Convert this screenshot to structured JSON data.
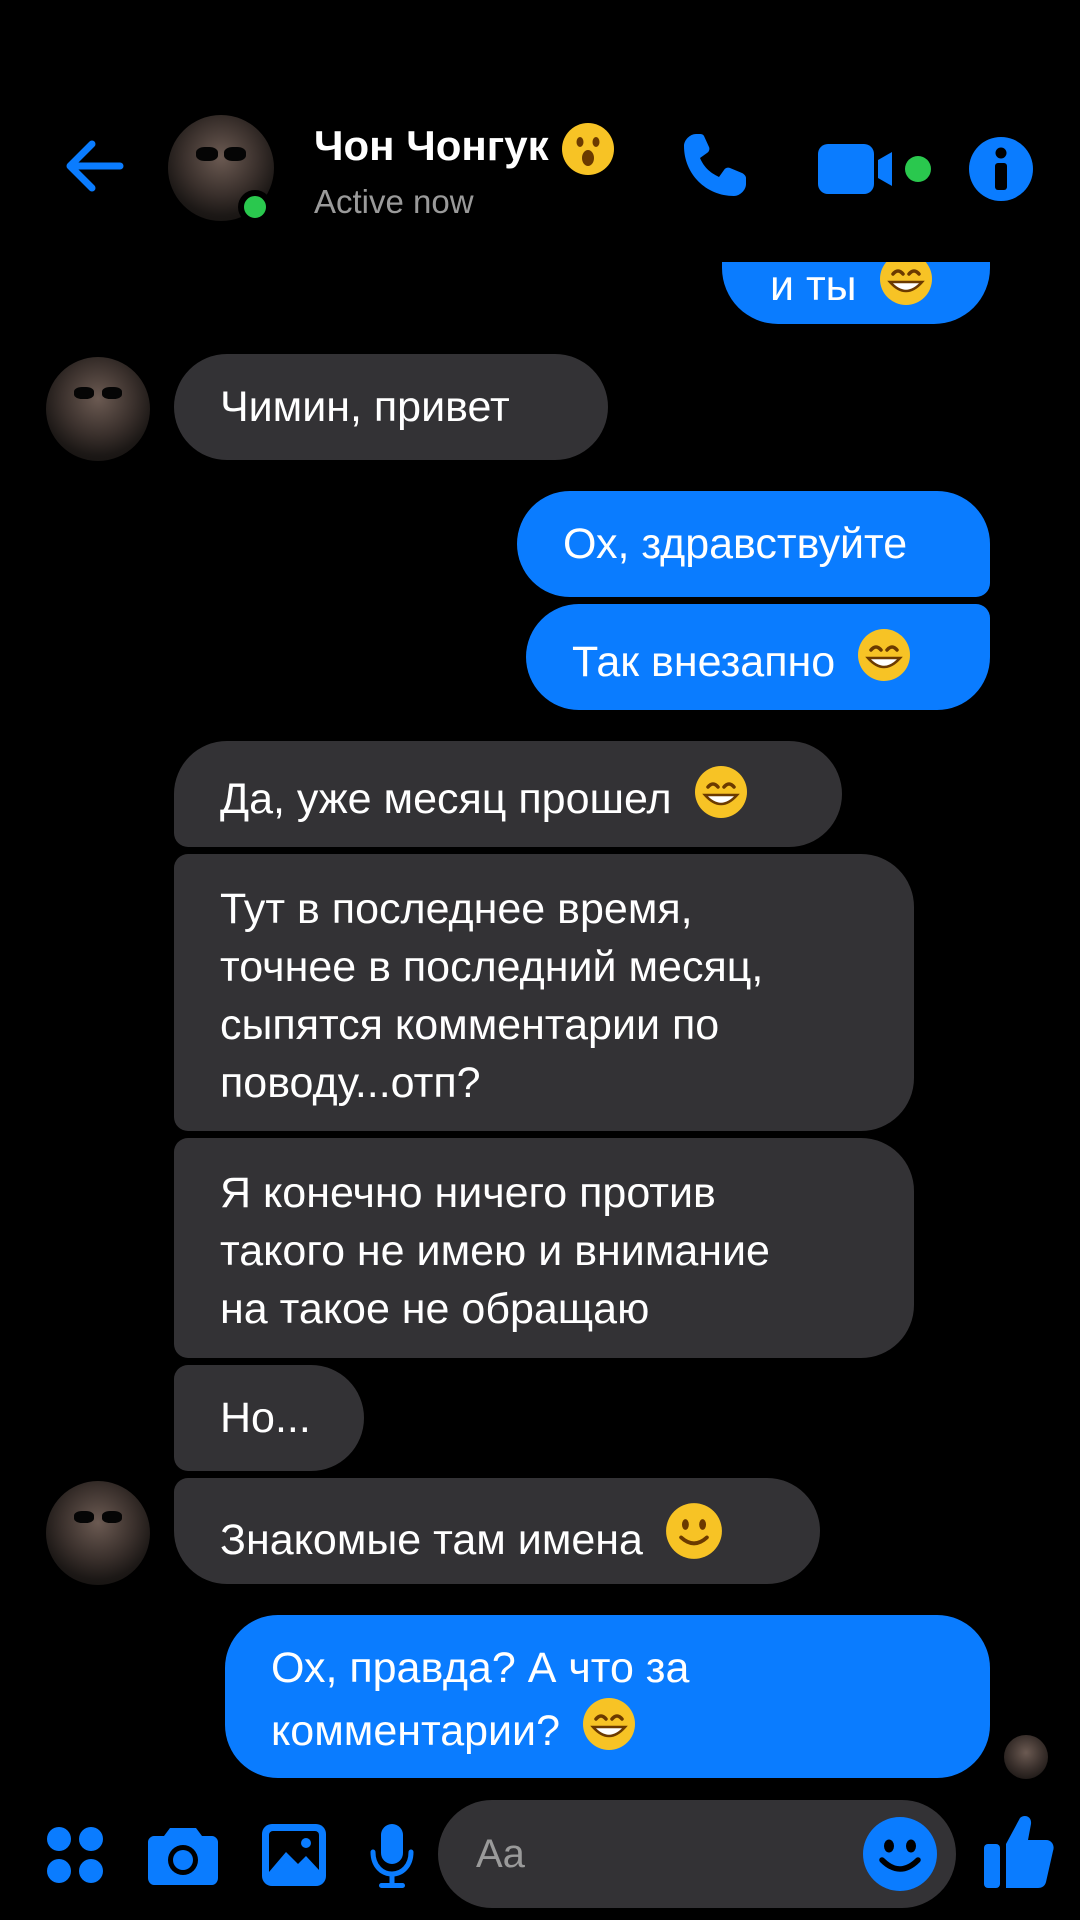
{
  "header": {
    "contact_name": "Чон Чонгук",
    "status": "Active now"
  },
  "messages": [
    {
      "direction": "outgoing",
      "text": "и ты",
      "emoji": "grinning-face-icon",
      "partial": true
    },
    {
      "direction": "incoming",
      "text": "Чимин, привет"
    },
    {
      "direction": "outgoing",
      "text": "Ох, здравствуйте"
    },
    {
      "direction": "outgoing",
      "text": "Так внезапно",
      "emoji": "grinning-face-icon"
    },
    {
      "direction": "incoming",
      "text": "Да, уже месяц прошел",
      "emoji": "grinning-face-icon"
    },
    {
      "direction": "incoming",
      "lines": [
        "Тут в последнее время,",
        "точнее в последний месяц,",
        "сыпятся комментарии по",
        "поводу...отп?"
      ]
    },
    {
      "direction": "incoming",
      "lines": [
        "Я конечно ничего против",
        "такого не имею и внимание",
        "на такое не обращаю"
      ]
    },
    {
      "direction": "incoming",
      "text": "Но..."
    },
    {
      "direction": "incoming",
      "text": "Знакомые там имена",
      "emoji": "slightly-smiling-face-icon"
    },
    {
      "direction": "outgoing",
      "lines": [
        "Ох, правда? А что за",
        "комментарии?"
      ],
      "emoji": "grinning-face-icon"
    }
  ],
  "composer": {
    "placeholder": "Aa"
  },
  "colors": {
    "accent": "#0a7cff",
    "incoming_bubble": "#333235",
    "background": "#000000",
    "online": "#2ac84e"
  }
}
